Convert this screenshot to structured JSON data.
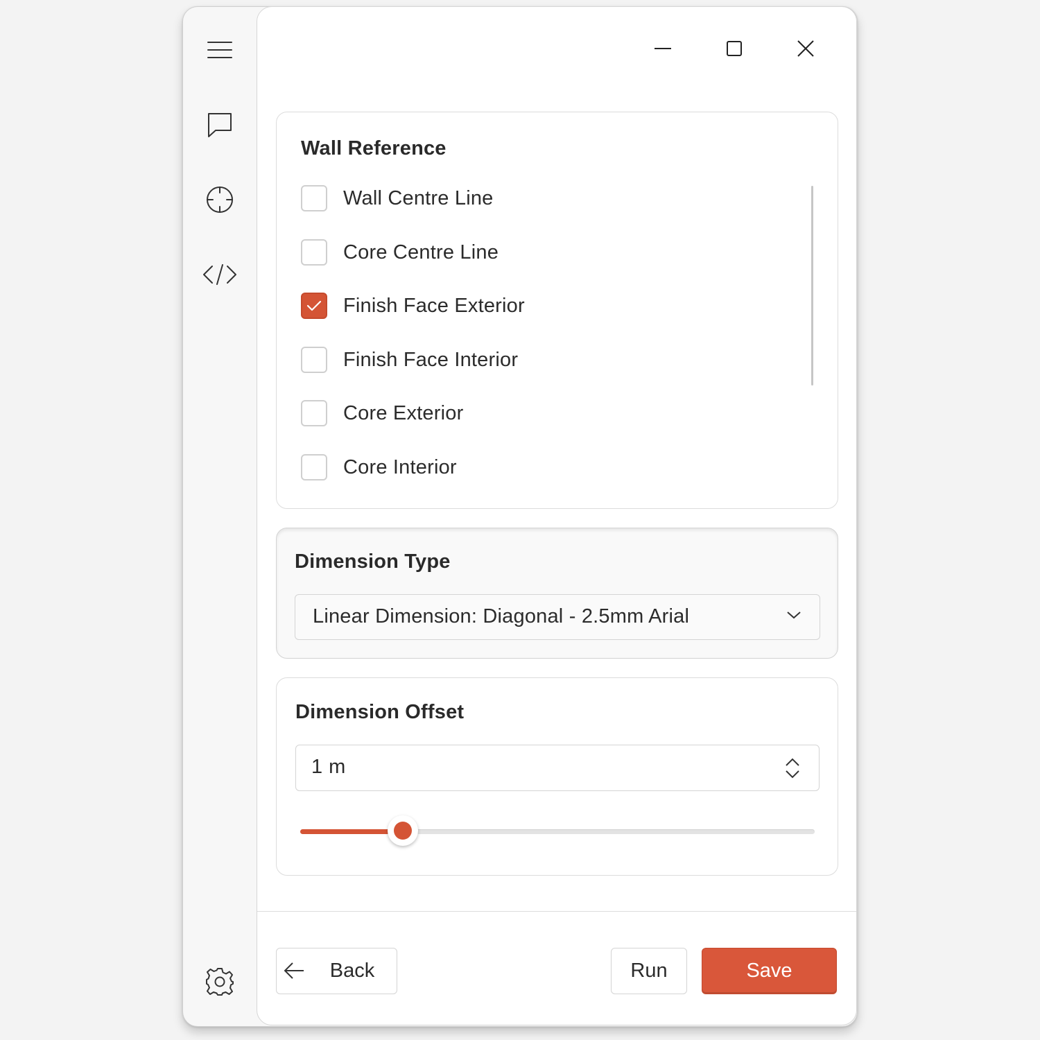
{
  "sidebar": {
    "icons": [
      "hamburger-menu-icon",
      "chat-bubble-icon",
      "crosshair-icon",
      "code-icon",
      "gear-icon"
    ]
  },
  "titlebar": {
    "controls": [
      "minimize-icon",
      "maximize-icon",
      "close-icon"
    ]
  },
  "wall_reference": {
    "title": "Wall Reference",
    "options": [
      {
        "label": "Wall Centre Line",
        "checked": false
      },
      {
        "label": "Core Centre Line",
        "checked": false
      },
      {
        "label": "Finish Face Exterior",
        "checked": true
      },
      {
        "label": "Finish Face Interior",
        "checked": false
      },
      {
        "label": "Core Exterior",
        "checked": false
      },
      {
        "label": "Core Interior",
        "checked": false
      }
    ]
  },
  "dimension_type": {
    "title": "Dimension Type",
    "selected": "Linear Dimension: Diagonal - 2.5mm Arial"
  },
  "dimension_offset": {
    "title": "Dimension Offset",
    "value": "1 m",
    "slider_fraction": 0.2
  },
  "footer": {
    "back_label": "Back",
    "run_label": "Run",
    "save_label": "Save"
  },
  "colors": {
    "accent": "#d45435",
    "background": "#f3f3f3"
  }
}
